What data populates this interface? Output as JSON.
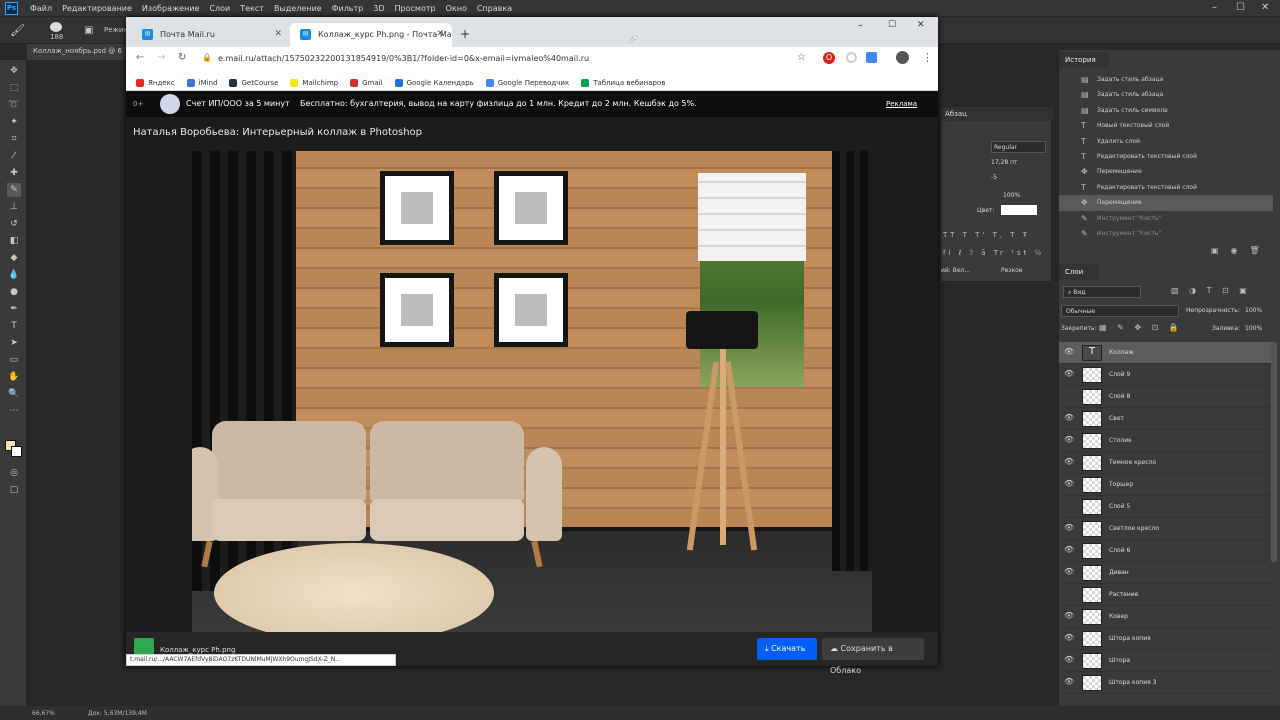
{
  "ps": {
    "menu": [
      "Файл",
      "Редактирование",
      "Изображение",
      "Слои",
      "Текст",
      "Выделение",
      "Фильтр",
      "3D",
      "Просмотр",
      "Окно",
      "Справка"
    ],
    "options_size": "188",
    "options_mode": "Режим:",
    "doc_tab": "Коллаж_ноябрь.psd @ 6",
    "status_zoom": "66,67%",
    "status_doc": "Док: 5,63M/139,4M",
    "history_tab": "История",
    "history_items": [
      "Задать стиль абзаца",
      "Задать стиль абзаца",
      "Задать стиль символа",
      "Новый текстовый слой",
      "Удалить слой",
      "Редактировать текстовый слой",
      "Перемещение",
      "Редактировать текстовый слой",
      "Перемещение",
      "Инструмент \"Кисть\"",
      "Инструмент \"Кисть\""
    ],
    "char_panel": {
      "tab": "Абзац",
      "font_style": "Regular",
      "size": "17,28 пт",
      "tracking": "-5",
      "scale": "100%",
      "color_label": "Цвет:",
      "aa": "Резкое",
      "lang": "ий: Вел..."
    },
    "layers": {
      "tab": "Слои",
      "filter": "Вид",
      "blend": "Обычные",
      "opacity_label": "Непрозрачность:",
      "opacity": "100%",
      "lock_label": "Закрепить:",
      "fill_label": "Заливка:",
      "fill": "100%",
      "items": [
        "Коллаж",
        "Слой 9",
        "Слой 8",
        "Свет",
        "Столик",
        "Темное кресло",
        "Торшер",
        "Слой 5",
        "Светлое кресло",
        "Слой 6",
        "Диван",
        "Растение",
        "Ковер",
        "Штора копия",
        "Штора",
        "Штора копия 3"
      ]
    }
  },
  "browser": {
    "tabs": [
      {
        "title": "Почта Mail.ru",
        "fav": "✉"
      },
      {
        "title": "Коллаж_курс Ph.png - Почта Mail",
        "fav": "✉"
      }
    ],
    "new_tab": "+",
    "url": "e.mail.ru/attach/15750232200131854919/0%3B1/?folder-id=0&x-email=ivmaleo%40mail.ru",
    "bookmarks": [
      {
        "label": "Яндекс",
        "color": "#e62a1d"
      },
      {
        "label": "iMind",
        "color": "#3f6fd8"
      },
      {
        "label": "GetCourse",
        "color": "#20384a"
      },
      {
        "label": "Mailchimp",
        "color": "#ffe01b"
      },
      {
        "label": "Gmail",
        "color": "#d93025"
      },
      {
        "label": "Google Календарь",
        "color": "#1a73e8"
      },
      {
        "label": "Google Переводчик",
        "color": "#4285f4"
      },
      {
        "label": "Таблица вебинаров",
        "color": "#0f9d58"
      }
    ],
    "ad": {
      "age": "0+",
      "brand": "Счет ИП/ООО за 5 минут",
      "text": "Бесплатно: бухгалтерия, вывод на карту физлица до 1 млн. Кредит до 2 млн. Кешбэк до 5%.",
      "label": "Реклама"
    },
    "viewer_title": "Наталья Воробьева: Интерьерный коллаж в Photoshop",
    "attachment_name": "Коллаж_курс Ph.png",
    "download": "Скачать",
    "save_cloud": "Сохранить в Облако",
    "status_url": "t.mail.ru/.../AACW7AEfdVy8iDAO7zKTDUNlMuMjWXh9OumgJSdX-Z_N..."
  }
}
